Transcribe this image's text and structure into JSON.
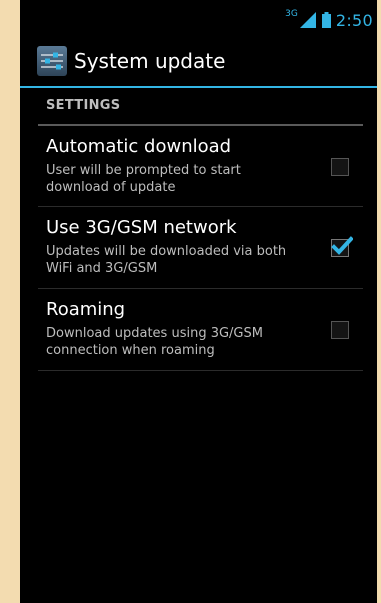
{
  "status_bar": {
    "network_type": "3G",
    "time": "2:50",
    "signal_icon": "signal-bars-icon",
    "battery_icon": "battery-icon"
  },
  "action_bar": {
    "title": "System update",
    "app_icon": "settings-sliders-icon",
    "accent_color": "#33b5e5"
  },
  "settings": {
    "section_header": "SETTINGS",
    "items": [
      {
        "title": "Automatic download",
        "summary": "User will be prompted to start download of update",
        "checked": false
      },
      {
        "title": "Use 3G/GSM network",
        "summary": "Updates will be downloaded via both WiFi and 3G/GSM",
        "checked": true
      },
      {
        "title": "Roaming",
        "summary": "Download updates using 3G/GSM connection when roaming",
        "checked": false
      }
    ]
  }
}
